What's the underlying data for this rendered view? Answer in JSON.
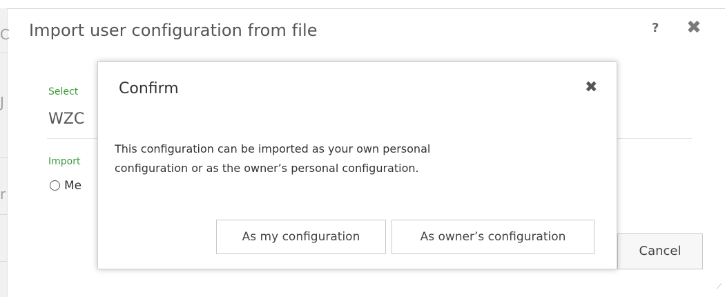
{
  "outer_dialog": {
    "title": "Import user configuration from file",
    "help_glyph": "?",
    "close_glyph": "✖",
    "file_field": {
      "label": "Select",
      "value": "WZC"
    },
    "import_as": {
      "label": "Import",
      "option_visible": "Me"
    },
    "buttons": {
      "cancel": "Cancel"
    }
  },
  "background_page": {
    "bleed_chars": [
      "C",
      "J",
      "r"
    ]
  },
  "confirm_dialog": {
    "title": "Confirm",
    "close_glyph": "✖",
    "message_line1": "This configuration can be imported as your own personal",
    "message_line2": "configuration or as the owner’s personal configuration.",
    "buttons": {
      "mine": "As my configuration",
      "owner": "As owner’s configuration"
    }
  },
  "icons": {
    "close": "close-icon",
    "help": "help-icon",
    "radio": "radio-icon",
    "resize": "resize-grip-icon"
  },
  "colors": {
    "label_green": "#3c9b3c",
    "text_gray": "#555555"
  }
}
